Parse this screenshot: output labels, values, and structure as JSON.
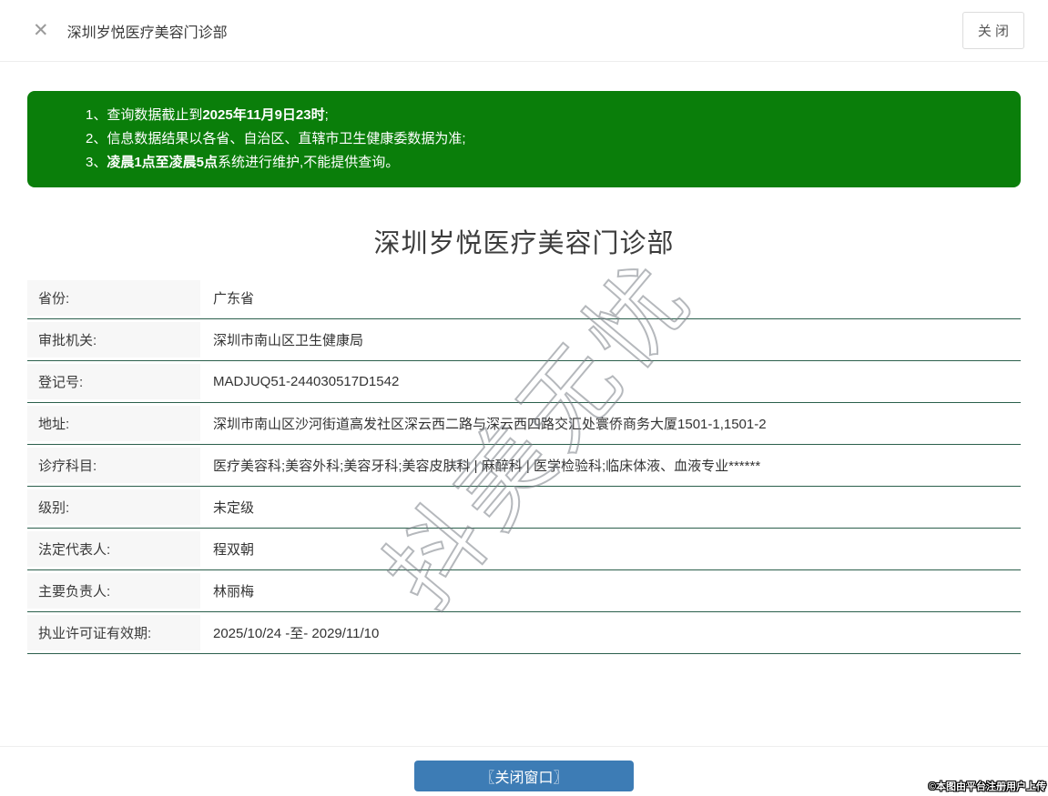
{
  "header": {
    "close_icon": "✕",
    "title": "深圳岁悦医疗美容门诊部",
    "close_button_label": "关 闭"
  },
  "notice": {
    "lines": [
      {
        "pre": "1、查询数据截止到",
        "bold": "2025年11月9日23时",
        "post": ";"
      },
      {
        "pre": "2、信息数据结果以各省、自治区、直辖市卫生健康委数据为准;",
        "bold": "",
        "post": ""
      },
      {
        "pre": "3、",
        "bold": "凌晨1点至凌晨5点",
        "post": "系统进行维护,不能提供查询。"
      }
    ]
  },
  "main": {
    "title": "深圳岁悦医疗美容门诊部",
    "fields": [
      {
        "label": "省份:",
        "value": "广东省"
      },
      {
        "label": "审批机关:",
        "value": "深圳市南山区卫生健康局"
      },
      {
        "label": "登记号:",
        "value": "MADJUQ51-244030517D1542"
      },
      {
        "label": "地址:",
        "value": "深圳市南山区沙河街道高发社区深云西二路与深云西四路交汇处寰侨商务大厦1501-1,1501-2"
      },
      {
        "label": "诊疗科目:",
        "value": "医疗美容科;美容外科;美容牙科;美容皮肤科 | 麻醉科 | 医学检验科;临床体液、血液专业******"
      },
      {
        "label": "级别:",
        "value": "未定级"
      },
      {
        "label": "法定代表人:",
        "value": "程双朝"
      },
      {
        "label": "主要负责人:",
        "value": "林丽梅"
      },
      {
        "label": "执业许可证有效期:",
        "value": "2025/10/24 -至- 2029/11/10"
      }
    ],
    "watermark": "抖美无忧"
  },
  "footer": {
    "close_window_button": "〖关闭窗口〗",
    "credit": "©本图由平台注册用户上传"
  },
  "colors": {
    "notice_green": "#0a7e0a",
    "row_divider_green": "#2b5f4c",
    "button_blue": "#3d7cb5"
  }
}
